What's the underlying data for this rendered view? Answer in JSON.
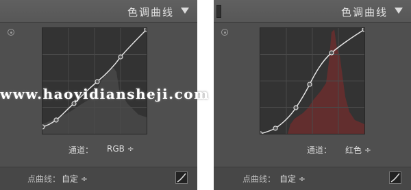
{
  "left_panel": {
    "title": "色调曲线",
    "channel_label": "通道：",
    "channel_value": "RGB ÷",
    "point_curve_label": "点曲线：",
    "point_curve_value": "自定 ÷"
  },
  "right_panel": {
    "title": "色调曲线",
    "channel_label": "通道：",
    "channel_value": "红色 ÷",
    "point_curve_label": "点曲线：",
    "point_curve_value": "自定 ÷"
  },
  "watermark": "www.haoyidiansheji.com",
  "colors": {
    "panel_bg": "#4f4f4f",
    "curve_bg": "#333333",
    "grid": "#4a4a4a",
    "histogram_left": "#4a4a4a",
    "histogram_right": "#6b2e2e"
  },
  "icons": [
    "collapse-triangle-icon",
    "target-adjust-icon",
    "edit-point-curve-icon"
  ]
}
